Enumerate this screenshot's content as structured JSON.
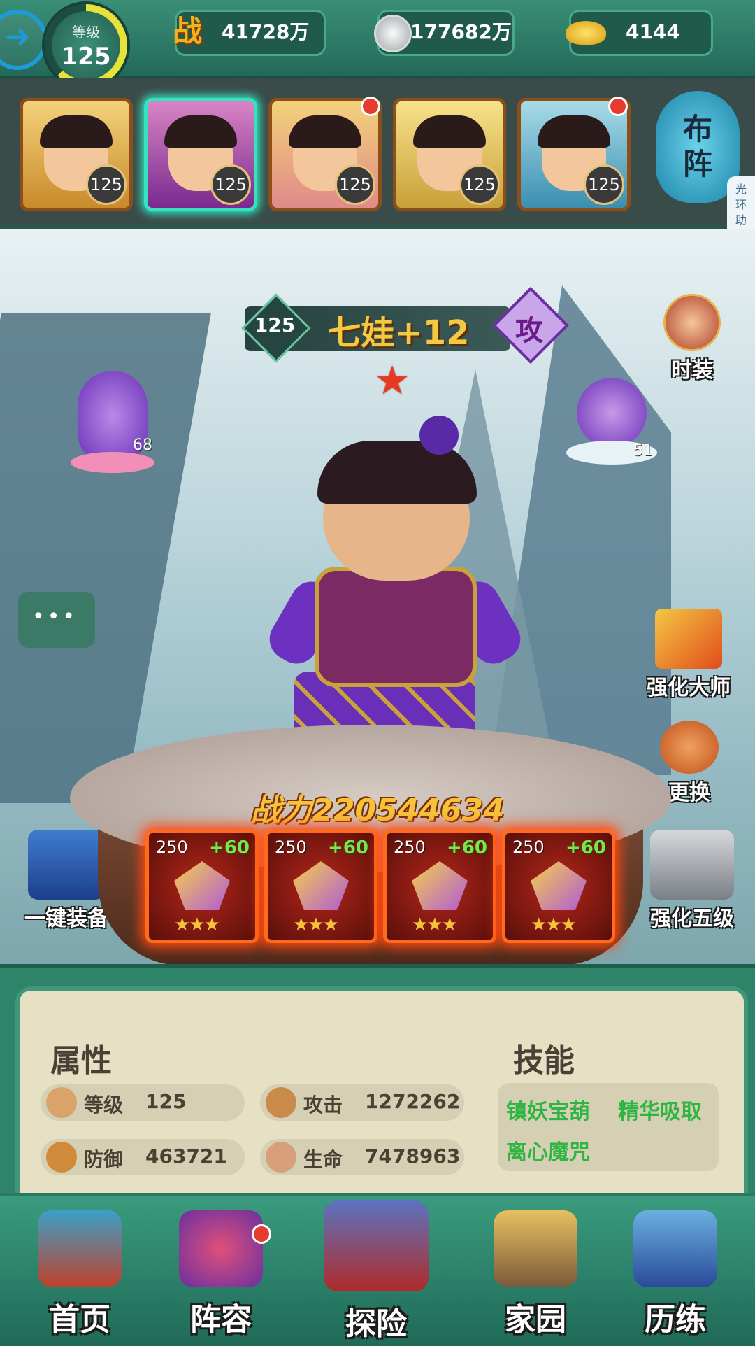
{
  "header": {
    "level_label": "等级",
    "level_value": "125",
    "power_icon": "战",
    "power_value": "41728万",
    "coin_value": "177682万",
    "gold_value": "4144"
  },
  "roster": {
    "heroes": [
      {
        "level": "125"
      },
      {
        "level": "125"
      },
      {
        "level": "125"
      },
      {
        "level": "125"
      },
      {
        "level": "125"
      }
    ],
    "formation_label": "布阵",
    "helper_label": "光环助手"
  },
  "hero": {
    "level": "125",
    "name": "七娃+12",
    "role": "攻",
    "power": "战力220544634"
  },
  "side": {
    "gourd_count_left": "68",
    "gourd_count_right": "51",
    "fashion": "时装",
    "master": "强化大师",
    "replace": "更换",
    "one_key": "一键装备",
    "enhance_five": "强化五级"
  },
  "equipment": [
    {
      "level": "250",
      "bonus": "+60",
      "stars": "★★★"
    },
    {
      "level": "250",
      "bonus": "+60",
      "stars": "★★★"
    },
    {
      "level": "250",
      "bonus": "+60",
      "stars": "★★★"
    },
    {
      "level": "250",
      "bonus": "+60",
      "stars": "★★★"
    }
  ],
  "stats": {
    "attr_title": "属性",
    "skill_title": "技能",
    "level_label": "等级",
    "level_value": "125",
    "attack_label": "攻击",
    "attack_value": "1272262",
    "defense_label": "防御",
    "defense_value": "463721",
    "hp_label": "生命",
    "hp_value": "7478963",
    "skills": [
      "镇妖宝葫",
      "精华吸取",
      "离心魔咒"
    ]
  },
  "nav": {
    "home": "首页",
    "lineup": "阵容",
    "explore": "探险",
    "homeland": "家园",
    "training": "历练"
  },
  "colors": {
    "accent_green": "#2d8468",
    "gold": "#f3c843",
    "skill_green": "#2fb544",
    "equip_glow": "#ff4a12"
  }
}
